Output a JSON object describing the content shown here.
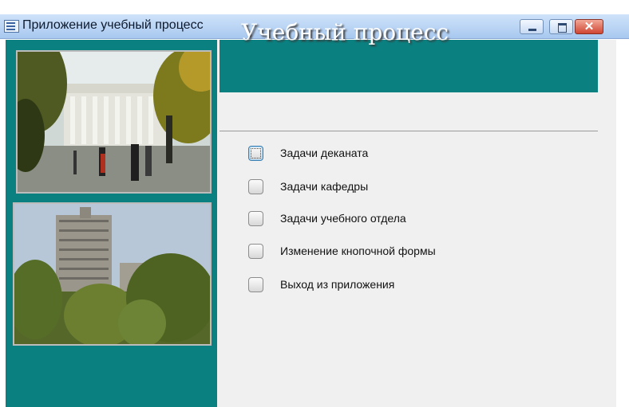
{
  "window": {
    "title": "Приложение учебный процесс",
    "icon": "access-form-icon",
    "buttons": {
      "minimize": "minimize-icon",
      "maximize": "maximize-icon",
      "close": "close-icon"
    }
  },
  "form": {
    "title": "Учебный процесс",
    "accent_color": "#0b8080",
    "menu_items": [
      {
        "label": "Задачи деканата"
      },
      {
        "label": "Задачи кафедры"
      },
      {
        "label": "Задачи учебного отдела"
      },
      {
        "label": "Изменение кнопочной формы"
      },
      {
        "label": "Выход из приложения"
      }
    ],
    "focused_item": 0,
    "photos": [
      {
        "subject": "university-main-building-photo"
      },
      {
        "subject": "university-tower-building-photo"
      }
    ]
  }
}
